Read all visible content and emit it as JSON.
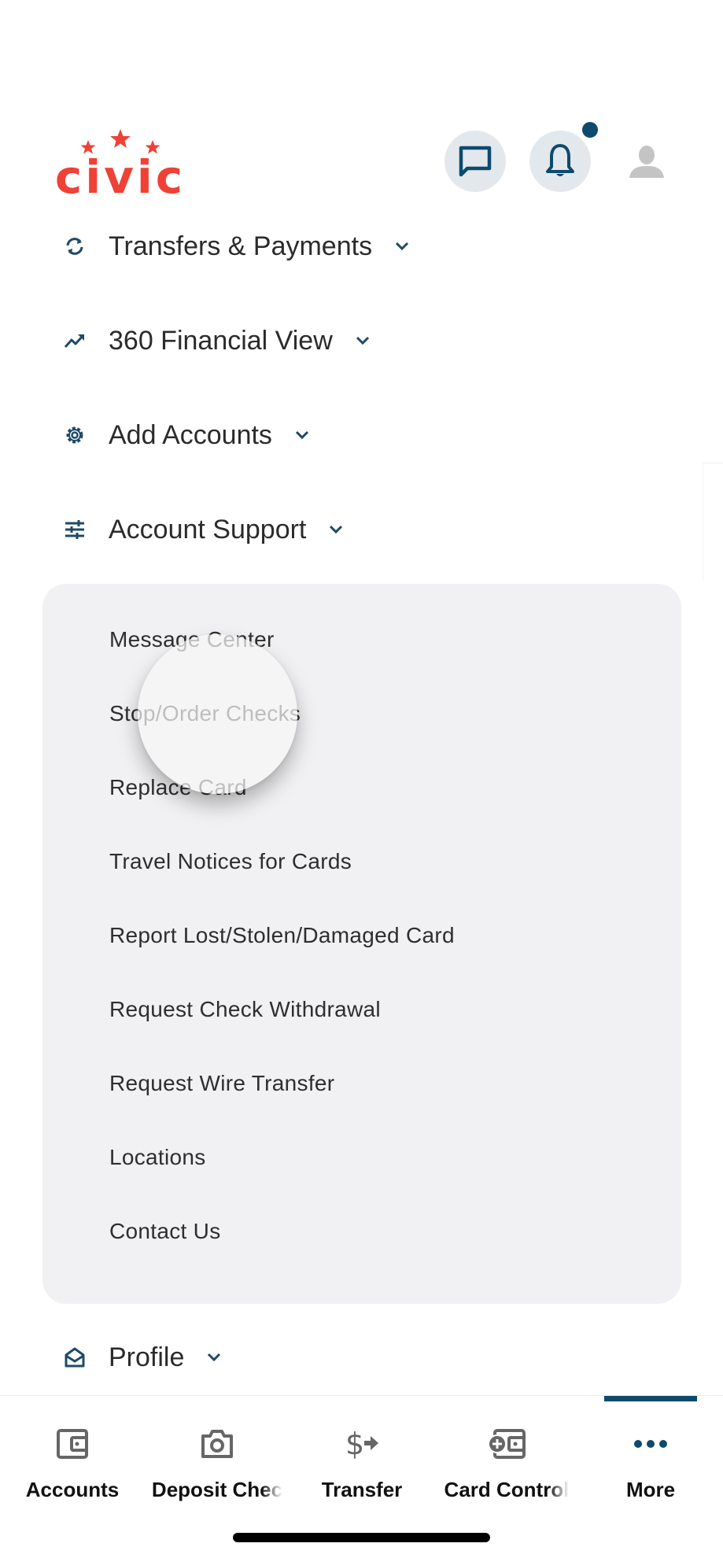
{
  "brand": {
    "name": "civic",
    "logo_color": "#ef4136",
    "accent_color": "#0d4a6e"
  },
  "header": {
    "chat_button_icon": "chat-bubble-icon",
    "notifications_icon": "bell-icon",
    "notification_badge": true,
    "profile_icon": "user-silhouette-icon"
  },
  "menu": {
    "sections": [
      {
        "label": "Transfers & Payments",
        "icon": "sync-arrows-icon",
        "expanded": false
      },
      {
        "label": "360 Financial View",
        "icon": "trending-up-icon",
        "expanded": false
      },
      {
        "label": "Add Accounts",
        "icon": "gear-icon",
        "expanded": false
      },
      {
        "label": "Account Support",
        "icon": "sliders-icon",
        "expanded": true
      },
      {
        "label": "Profile",
        "icon": "open-envelope-icon",
        "expanded": false
      }
    ],
    "account_support_items": [
      "Message Center",
      "Stop/Order Checks",
      "Replace Card",
      "Travel Notices for Cards",
      "Report Lost/Stolen/Damaged Card",
      "Request Check Withdrawal",
      "Request Wire Transfer",
      "Locations",
      "Contact Us"
    ]
  },
  "tabbar": {
    "active": "More",
    "tabs": [
      {
        "label": "Accounts",
        "icon": "wallet-icon"
      },
      {
        "label": "Deposit Chec",
        "icon": "camera-icon"
      },
      {
        "label": "Transfer",
        "icon": "dollar-transfer-icon"
      },
      {
        "label": "Card Control",
        "icon": "card-plus-icon"
      },
      {
        "label": "More",
        "icon": "more-dots-icon"
      }
    ]
  }
}
